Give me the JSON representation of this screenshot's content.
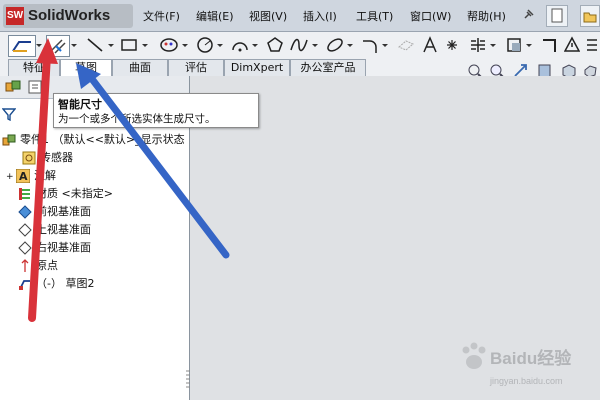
{
  "app": {
    "logo_badge": "SW",
    "title": "SolidWorks"
  },
  "menu": [
    "文件(F)",
    "编辑(E)",
    "视图(V)",
    "插入(I)",
    "工具(T)",
    "窗口(W)",
    "帮助(H)"
  ],
  "tabs": [
    "特征",
    "草图",
    "曲面",
    "评估",
    "DimXpert",
    "办公室产品"
  ],
  "active_tab": "草图",
  "tooltip": {
    "title": "智能尺寸",
    "description": "为一个或多个所选实体生成尺寸。"
  },
  "tree": {
    "root": "零件1 （默认<<默认>_显示状态",
    "items": [
      "传感器",
      "注解",
      "材质 <未指定>",
      "前视基准面",
      "上视基准面",
      "右视基准面",
      "原点",
      "（-） 草图2"
    ]
  },
  "watermark": {
    "main": "Baidu经验",
    "url": "jingyan.baidu.com"
  },
  "colors": {
    "arrow_red": "#d9323a",
    "arrow_blue": "#3565c6",
    "logo_red": "#c62828",
    "graphics_bg": "#dfe1e4"
  },
  "icons": [
    "sketch-icon",
    "smart-dimension-icon",
    "line-icon",
    "rectangle-icon",
    "spline-icon",
    "circle-icon",
    "arc-icon",
    "polygon-icon",
    "ellipse-icon",
    "trim-icon",
    "text-icon",
    "point-icon",
    "filter-icon",
    "zoom-fit-icon",
    "zoom-area-icon",
    "view-orientation-icon"
  ]
}
